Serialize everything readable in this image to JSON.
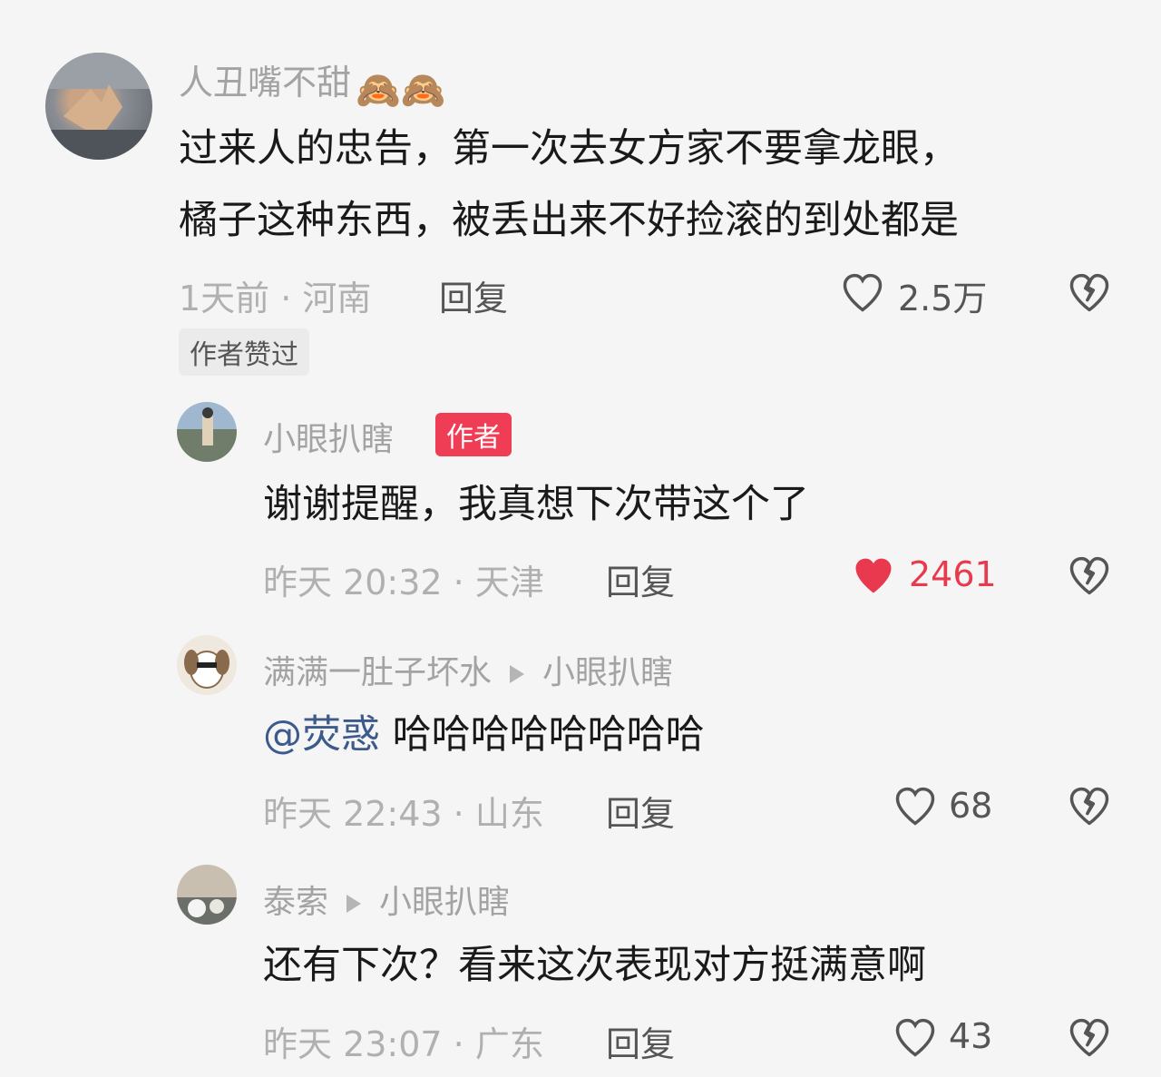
{
  "comments": [
    {
      "author": "人丑嘴不甜",
      "author_emoji": "🙈🙈",
      "content_lines": [
        "过来人的忠告，第一次去女方家不要拿龙眼，",
        "橘子这种东西，被丢出来不好捡滚的到处都是"
      ],
      "time_location": "1天前 · 河南",
      "reply_label": "回复",
      "likes": "2.5万",
      "liked_by_author": "作者赞过"
    },
    {
      "author": "小眼扒瞎",
      "author_badge": "作者",
      "content": "谢谢提醒，我真想下次带这个了",
      "time_location": "昨天 20:32 · 天津",
      "reply_label": "回复",
      "likes": "2461"
    },
    {
      "author": "满满一肚子坏水",
      "reply_to": "小眼扒瞎",
      "mention": "@荧惑",
      "content": "哈哈哈哈哈哈哈哈",
      "time_location": "昨天 22:43 · 山东",
      "reply_label": "回复",
      "likes": "68"
    },
    {
      "author": "泰索",
      "reply_to": "小眼扒瞎",
      "content": "还有下次？看来这次表现对方挺满意啊",
      "time_location": "昨天 23:07 · 广东",
      "reply_label": "回复",
      "likes": "43"
    }
  ],
  "icons": {
    "like": "heart-outline-icon",
    "liked": "heart-filled-icon",
    "dislike": "broken-heart-icon"
  },
  "colors": {
    "liked_red": "#e8394e",
    "author_badge": "#ef3d56",
    "mention_blue": "#3d5a8c"
  }
}
